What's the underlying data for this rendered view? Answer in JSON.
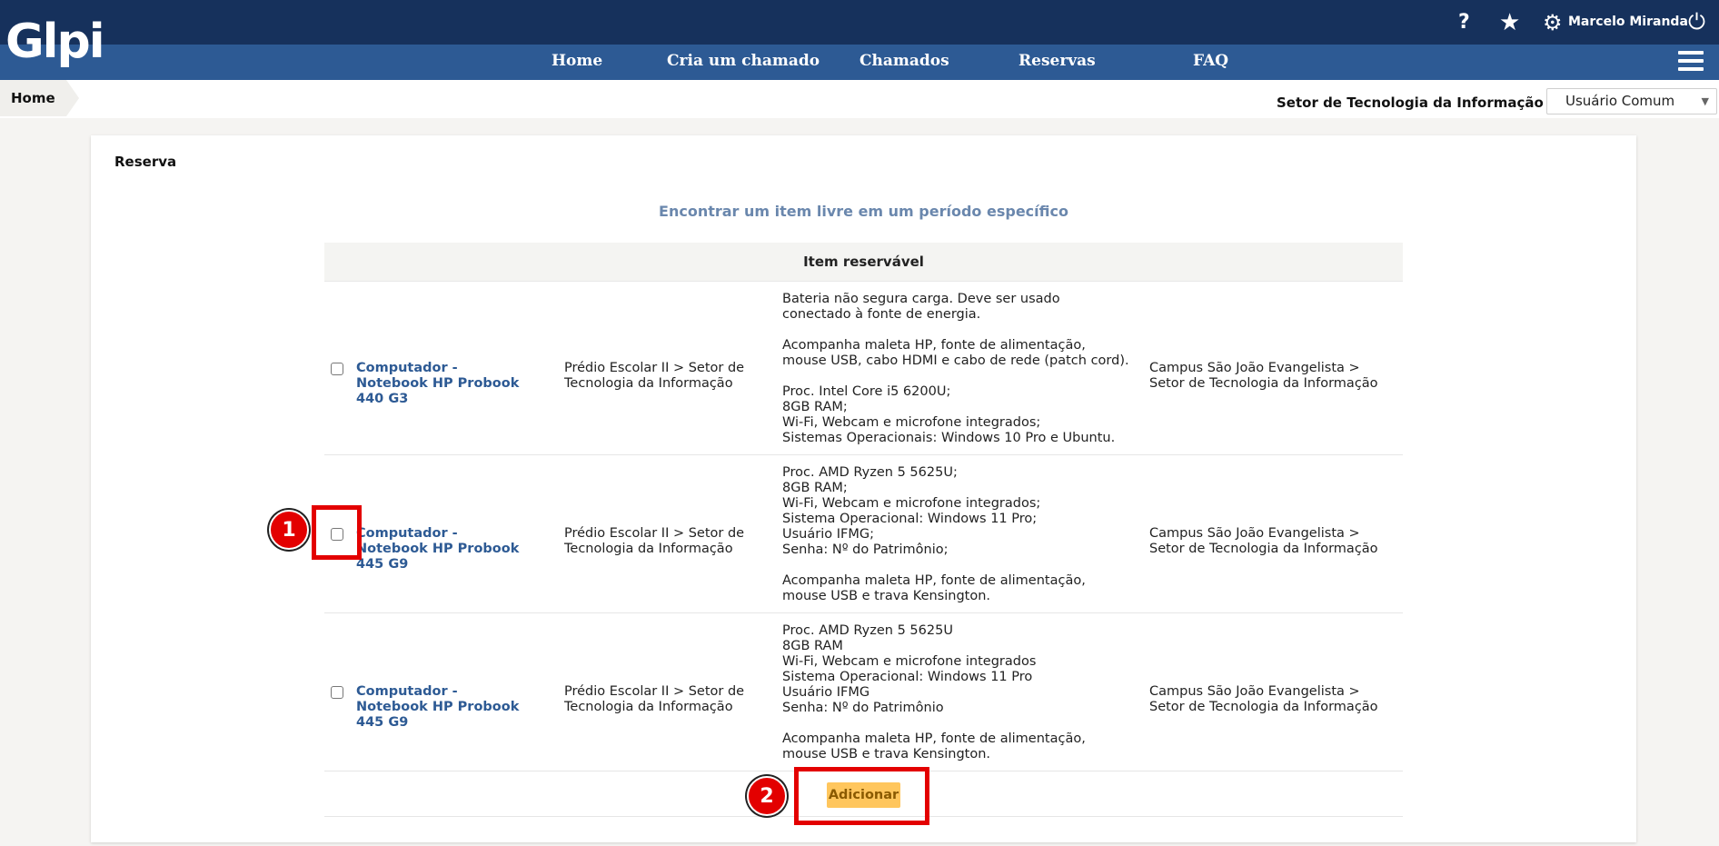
{
  "header": {
    "logo_text": "Glpi",
    "user_name": "Marcelo Miranda"
  },
  "icons": {
    "help": "?",
    "star": "★",
    "gear": "⚙",
    "power": "⏻"
  },
  "nav": {
    "items": [
      "Home",
      "Cria um chamado",
      "Chamados",
      "Reservas",
      "FAQ"
    ]
  },
  "breadcrumb": {
    "home": "Home"
  },
  "entity": {
    "label": "Setor de Tecnologia da Informação"
  },
  "profile": {
    "selected": "Usuário Comum"
  },
  "card": {
    "title": "Reserva",
    "find_link": "Encontrar um item livre em um período específico",
    "table_header": "Item reservável",
    "rows": [
      {
        "name": "Computador - Notebook HP Probook 440 G3",
        "location": "Prédio Escolar II > Setor de Tecnologia da Informação",
        "description": "Bateria não segura carga. Deve ser usado conectado à fonte de energia.\n\nAcompanha maleta HP, fonte de alimentação, mouse USB, cabo HDMI e cabo de rede (patch cord).\n\nProc. Intel Core i5 6200U;\n8GB RAM;\nWi-Fi, Webcam e microfone integrados;\nSistemas Operacionais: Windows 10 Pro e Ubuntu.",
        "campus": "Campus São João Evangelista > Setor de Tecnologia da Informação"
      },
      {
        "name": "Computador - Notebook HP Probook 445 G9",
        "location": "Prédio Escolar II > Setor de Tecnologia da Informação",
        "description": "Proc. AMD Ryzen 5 5625U;\n8GB RAM;\nWi-Fi, Webcam e microfone integrados;\nSistema Operacional: Windows 11 Pro;\nUsuário IFMG;\nSenha: Nº do Patrimônio;\n\nAcompanha maleta HP, fonte de alimentação, mouse USB e trava Kensington.",
        "campus": "Campus São João Evangelista > Setor de Tecnologia da Informação"
      },
      {
        "name": "Computador - Notebook HP Probook 445 G9",
        "location": "Prédio Escolar II > Setor de Tecnologia da Informação",
        "description": "Proc. AMD Ryzen 5 5625U\n8GB RAM\nWi-Fi, Webcam e microfone integrados\nSistema Operacional: Windows 11 Pro\nUsuário IFMG\nSenha: Nº do Patrimônio\n\nAcompanha maleta HP, fonte de alimentação, mouse USB e trava Kensington.",
        "campus": "Campus São João Evangelista > Setor de Tecnologia da Informação"
      }
    ],
    "add_button": "Adicionar"
  },
  "annotations": {
    "marker_1": "1",
    "marker_2": "2",
    "color": "#e30000"
  }
}
